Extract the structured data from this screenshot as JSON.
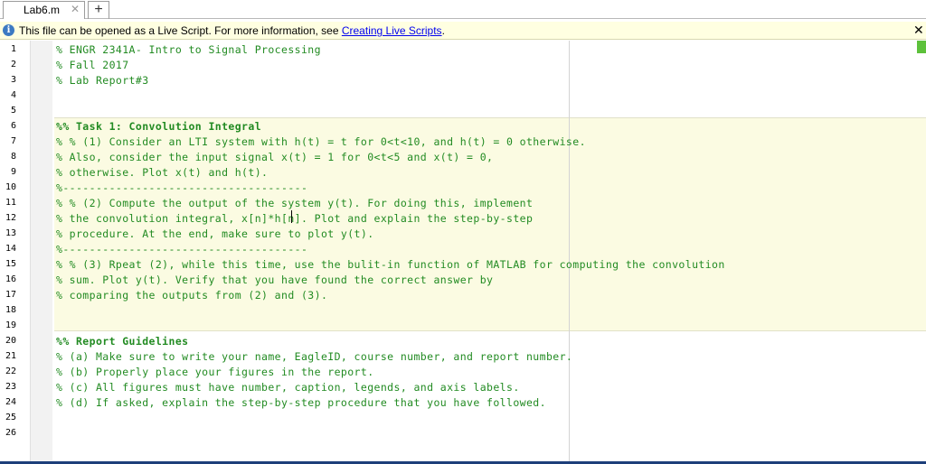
{
  "tab": {
    "filename": "Lab6.m",
    "close_glyph": "✕",
    "add_glyph": "+"
  },
  "infobar": {
    "icon_glyph": "i",
    "message": "This file can be opened as a Live Script. For more information, see ",
    "link_text": "Creating Live Scripts",
    "trailing": ".",
    "close_glyph": "✕"
  },
  "editor": {
    "line_numbers": [
      "1",
      "2",
      "3",
      "4",
      "5",
      "6",
      "7",
      "8",
      "9",
      "10",
      "11",
      "12",
      "13",
      "14",
      "15",
      "16",
      "17",
      "18",
      "19",
      "20",
      "21",
      "22",
      "23",
      "24",
      "25",
      "26"
    ],
    "lines": [
      "% ENGR 2341A- Intro to Signal Processing",
      "% Fall 2017",
      "% Lab Report#3",
      "",
      "",
      "%% Task 1: Convolution Integral",
      "% % (1) Consider an LTI system with h(t) = t for 0<t<10, and h(t) = 0 otherwise.",
      "% Also, consider the input signal x(t) = 1 for 0<t<5 and x(t) = 0,",
      "% otherwise. Plot x(t) and h(t).",
      "%-------------------------------------",
      "% % (2) Compute the output of the system y(t). For doing this, implement",
      "% the convolution integral, x[n]*h[n]. Plot and explain the step-by-step",
      "% procedure. At the end, make sure to plot y(t).",
      "%-------------------------------------",
      "% % (3) Rpeat (2), while this time, use the bulit-in function of MATLAB for computing the convolution",
      "% sum. Plot y(t). Verify that you have found the correct answer by",
      "% comparing the outputs from (2) and (3).",
      "",
      "",
      "%% Report Guidelines",
      "% (a) Make sure to write your name, EagleID, course number, and report number.",
      "% (b) Properly place your figures in the report.",
      "% (c) All figures must have number, caption, legends, and axis labels.",
      "% (d) If asked, explain the step-by-step procedure that you have followed.",
      "",
      ""
    ]
  },
  "colors": {
    "comment": "#228b22",
    "section_bg": "#fbfbe2",
    "infobar_bg": "#ffffe1",
    "link": "#0000ee"
  }
}
